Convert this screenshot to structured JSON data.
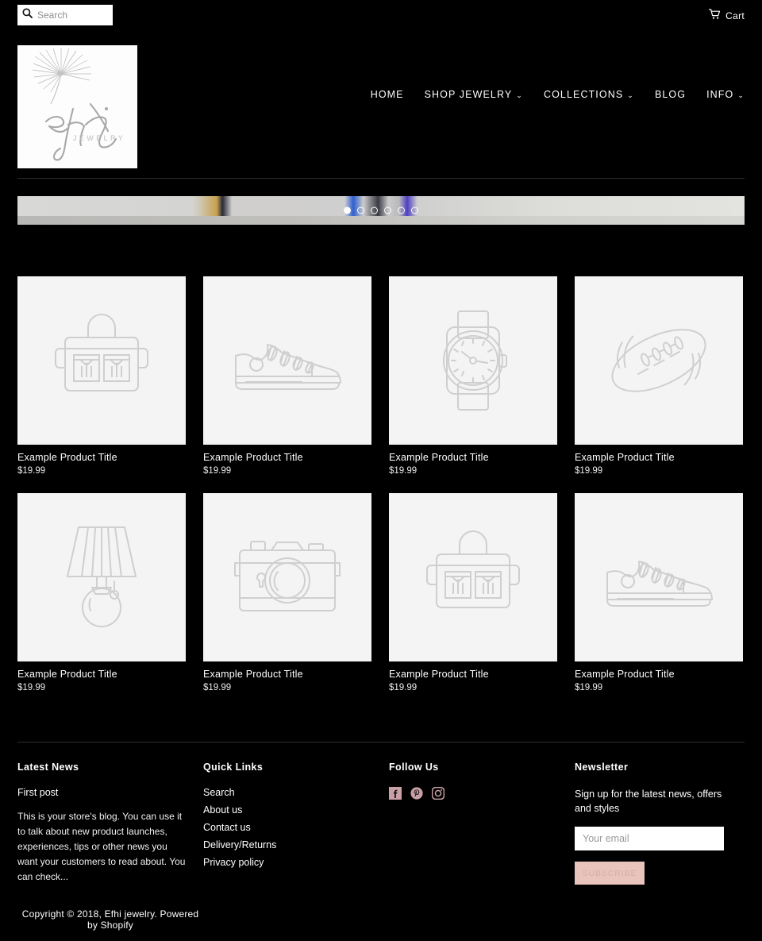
{
  "topbar": {
    "search_placeholder": "Search",
    "search_value": "",
    "search_icon": "search-icon",
    "cart_label": "Cart",
    "cart_icon": "shopping-cart-icon"
  },
  "header": {
    "logo_brand": "efhi",
    "logo_sub": "JEWELRY",
    "nav": [
      {
        "label": "HOME",
        "has_dropdown": false
      },
      {
        "label": "SHOP JEWELRY",
        "has_dropdown": true
      },
      {
        "label": "COLLECTIONS",
        "has_dropdown": true
      },
      {
        "label": "BLOG",
        "has_dropdown": false
      },
      {
        "label": "INFO",
        "has_dropdown": true
      }
    ],
    "caret": "⌄"
  },
  "slideshow": {
    "dot_count": 6,
    "active_dot": 1
  },
  "products": [
    {
      "icon": "handbag-icon",
      "title": "Example Product Title",
      "price": "$19.99"
    },
    {
      "icon": "sneaker-icon",
      "title": "Example Product Title",
      "price": "$19.99"
    },
    {
      "icon": "watch-icon",
      "title": "Example Product Title",
      "price": "$19.99"
    },
    {
      "icon": "football-icon",
      "title": "Example Product Title",
      "price": "$19.99"
    },
    {
      "icon": "lamp-icon",
      "title": "Example Product Title",
      "price": "$19.99"
    },
    {
      "icon": "camera-icon",
      "title": "Example Product Title",
      "price": "$19.99"
    },
    {
      "icon": "handbag-icon",
      "title": "Example Product Title",
      "price": "$19.99"
    },
    {
      "icon": "sneaker-icon",
      "title": "Example Product Title",
      "price": "$19.99"
    }
  ],
  "footer": {
    "latest_news": {
      "title": "Latest News",
      "post_title": "First post",
      "excerpt": "This is your store's blog. You can use it to talk about new product launches, experiences, tips or other news you want your customers to read about. You can check..."
    },
    "quick_links": {
      "title": "Quick Links",
      "links": [
        "Search",
        "About us",
        "Contact us",
        "Delivery/Returns",
        "Privacy policy"
      ]
    },
    "follow_us": {
      "title": "Follow Us",
      "icons": [
        "facebook-icon",
        "pinterest-icon",
        "instagram-icon"
      ],
      "icon_color": "#c9a0a5"
    },
    "newsletter": {
      "title": "Newsletter",
      "description": "Sign up for the latest news, offers and styles",
      "email_placeholder": "Your email",
      "email_value": "",
      "subscribe_label": "SUBSCRIBE",
      "subscribe_color": "#e8c4bc"
    },
    "copyright": "Copyright © 2018, Efhi jewelry. Powered by Shopify"
  }
}
